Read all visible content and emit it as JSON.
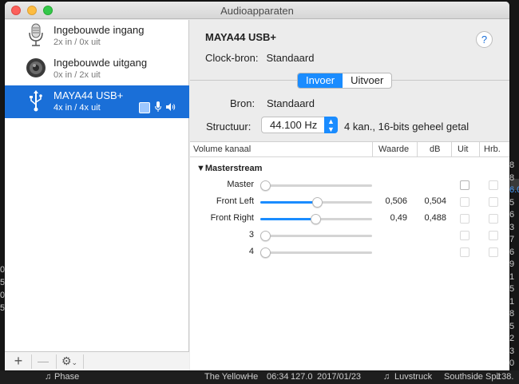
{
  "window": {
    "title": "Audioapparaten"
  },
  "sidebar": {
    "devices": [
      {
        "name": "Ingebouwde ingang",
        "sub": "2x in / 0x uit",
        "icon": "microphone-icon"
      },
      {
        "name": "Ingebouwde uitgang",
        "sub": "0x in / 2x uit",
        "icon": "speaker-icon"
      },
      {
        "name": "MAYA44 USB+",
        "sub": "4x in / 4x uit",
        "icon": "usb-icon",
        "selected": true
      }
    ],
    "add_label": "+",
    "remove_label": "—"
  },
  "main": {
    "device_title": "MAYA44 USB+",
    "help_label": "?",
    "clock_label": "Clock-bron:",
    "clock_value": "Standaard",
    "tabs": [
      "Invoer",
      "Uitvoer"
    ],
    "source_label": "Bron:",
    "source_value": "Standaard",
    "format_label": "Structuur:",
    "format_value": "44.100 Hz",
    "format_desc": "4 kan., 16-bits geheel getal"
  },
  "table": {
    "headers": [
      "Volume kanaal",
      "Waarde",
      "dB",
      "Uit",
      "Hrb."
    ],
    "group": "Masterstream",
    "rows": [
      {
        "channel": "Master",
        "level": 0.0,
        "value": "",
        "db": ""
      },
      {
        "channel": "Front Left",
        "level": 0.506,
        "value": "0,506",
        "db": "0,504"
      },
      {
        "channel": "Front Right",
        "level": 0.49,
        "value": "0,49",
        "db": "0,488"
      },
      {
        "channel": "3",
        "level": 0.0,
        "value": "",
        "db": ""
      },
      {
        "channel": "4",
        "level": 0.0,
        "value": "",
        "db": ""
      }
    ]
  },
  "background": {
    "bottom": [
      "Phase",
      "The YellowHe",
      "06:34",
      "127.0",
      "2017/01/23",
      "Luvstruck",
      "Southside Spir",
      "138."
    ],
    "left_nums": [
      "0",
      "5",
      "0",
      "5"
    ],
    "right_col": [
      "8",
      "8",
      "6.0",
      "5",
      "6",
      "3",
      "7",
      "6",
      "9",
      "1",
      "5",
      "1",
      "8",
      "5",
      "2",
      "3",
      "0"
    ]
  },
  "colors": {
    "accent": "#1a8cff",
    "selection": "#1a6fd8"
  }
}
